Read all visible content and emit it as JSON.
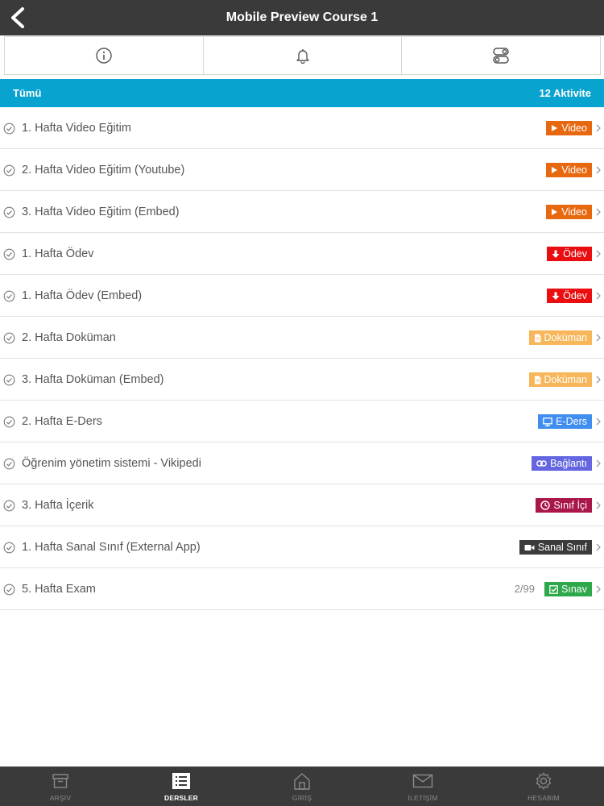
{
  "header": {
    "title": "Mobile Preview Course 1",
    "back_icon": "chevron-left-icon"
  },
  "tabs": [
    {
      "icon": "info-icon"
    },
    {
      "icon": "bell-icon"
    },
    {
      "icon": "toggle-settings-icon"
    }
  ],
  "filter": {
    "label": "Tümü",
    "count": "12 Aktivite",
    "color": "#09a3cf"
  },
  "activities": [
    {
      "title": "1. Hafta Video Eğitim",
      "badge": "Video",
      "badge_icon": "play-icon",
      "badge_color": "#e8680f",
      "score": ""
    },
    {
      "title": "2. Hafta Video Eğitim (Youtube)",
      "badge": "Video",
      "badge_icon": "play-icon",
      "badge_color": "#e8680f",
      "score": ""
    },
    {
      "title": "3. Hafta Video Eğitim (Embed)",
      "badge": "Video",
      "badge_icon": "play-icon",
      "badge_color": "#e8680f",
      "score": ""
    },
    {
      "title": "1. Hafta Ödev",
      "badge": "Ödev",
      "badge_icon": "download-icon",
      "badge_color": "#ea0e10",
      "score": ""
    },
    {
      "title": "1. Hafta Ödev (Embed)",
      "badge": "Ödev",
      "badge_icon": "download-icon",
      "badge_color": "#ea0e10",
      "score": ""
    },
    {
      "title": "2. Hafta Doküman",
      "badge": "Doküman",
      "badge_icon": "document-icon",
      "badge_color": "#f7b65a",
      "score": ""
    },
    {
      "title": "3. Hafta Doküman (Embed)",
      "badge": "Doküman",
      "badge_icon": "document-icon",
      "badge_color": "#f7b65a",
      "score": ""
    },
    {
      "title": "2. Hafta E-Ders",
      "badge": "E-Ders",
      "badge_icon": "monitor-icon",
      "badge_color": "#3f8ef0",
      "score": ""
    },
    {
      "title": "Öğrenim yönetim sistemi - Vikipedi",
      "badge": "Bağlantı",
      "badge_icon": "link-icon",
      "badge_color": "#6366e0",
      "score": ""
    },
    {
      "title": "3. Hafta İçerik",
      "badge": "Sınıf İçi",
      "badge_icon": "clock-icon",
      "badge_color": "#a9174a",
      "score": ""
    },
    {
      "title": "1. Hafta Sanal Sınıf (External App)",
      "badge": "Sanal Sınıf",
      "badge_icon": "video-camera-icon",
      "badge_color": "#3b3b3b",
      "score": ""
    },
    {
      "title": "5. Hafta Exam",
      "badge": "Sınav",
      "badge_icon": "checkbox-icon",
      "badge_color": "#2ea84a",
      "score": "2/99"
    }
  ],
  "bottom_nav": [
    {
      "label": "ARŞİV",
      "icon": "archive-icon",
      "active": false
    },
    {
      "label": "DERSLER",
      "icon": "list-icon",
      "active": true
    },
    {
      "label": "GİRİŞ",
      "icon": "home-icon",
      "active": false
    },
    {
      "label": "İLETİŞİM",
      "icon": "mail-icon",
      "active": false
    },
    {
      "label": "HESABIM",
      "icon": "gear-icon",
      "active": false
    }
  ]
}
